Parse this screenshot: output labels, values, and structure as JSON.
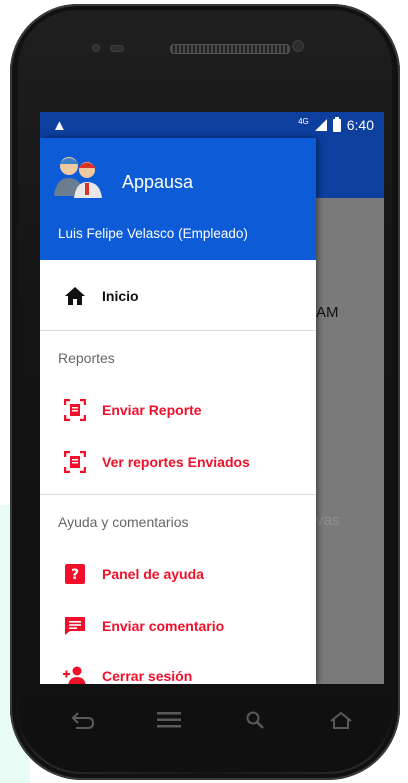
{
  "status_bar": {
    "warning_icon": "warning-icon",
    "network": "4G",
    "time": "6:40"
  },
  "drawer": {
    "app_name": "Appausa",
    "user_name": "Luis Felipe Velasco (Empleado)",
    "home_label": "Inicio",
    "sections": [
      {
        "title": "Reportes",
        "items": [
          {
            "label": "Enviar Reporte",
            "icon": "report-icon"
          },
          {
            "label": "Ver reportes Enviados",
            "icon": "report-list-icon"
          }
        ]
      },
      {
        "title": "Ayuda y comentarios",
        "items": [
          {
            "label": "Panel de ayuda",
            "icon": "help-icon"
          },
          {
            "label": "Enviar comentario",
            "icon": "feedback-icon"
          },
          {
            "label": "Cerrar sesión",
            "icon": "logout-icon"
          }
        ]
      }
    ]
  },
  "background": {
    "text_1": "AM",
    "text_2": "vas"
  },
  "colors": {
    "header_blue": "#0d5bd6",
    "statusbar_blue": "#0c3f9e",
    "accent_red": "#f0102a"
  }
}
